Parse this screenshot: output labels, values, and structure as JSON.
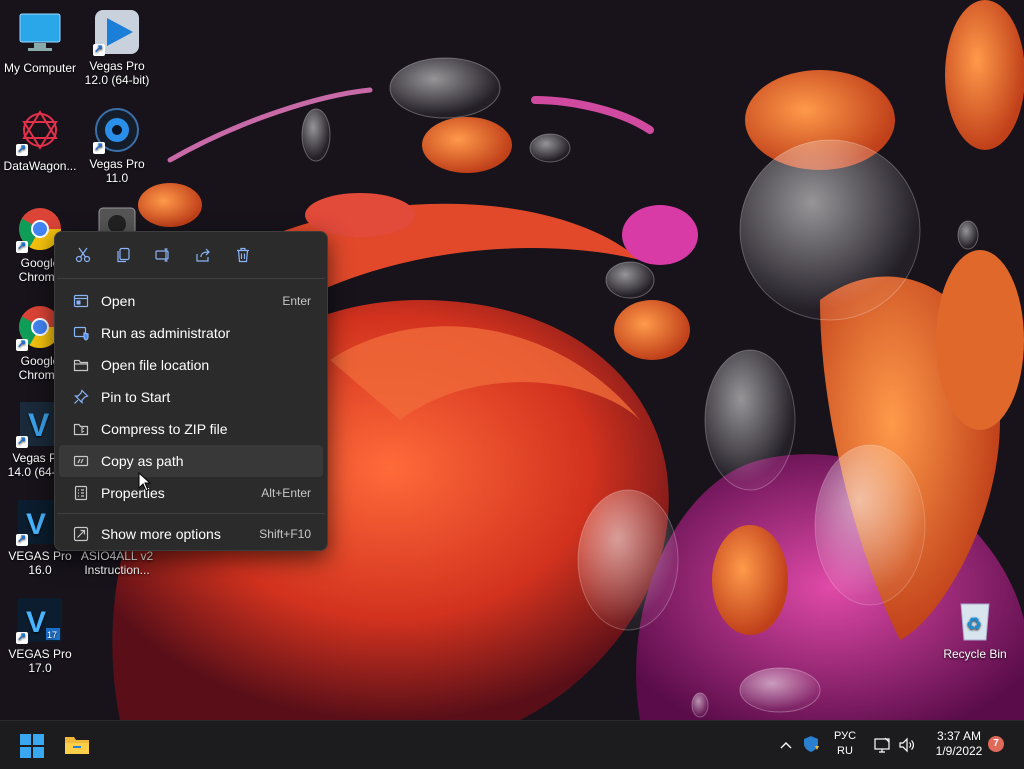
{
  "desktop": {
    "icons": [
      {
        "label": "My Computer"
      },
      {
        "label": "Vegas Pro 12.0 (64-bit)"
      },
      {
        "label": "DataWagon..."
      },
      {
        "label": "Vegas Pro 11.0"
      },
      {
        "label": "Google Chrome"
      },
      {
        "label": "Google Chrome"
      },
      {
        "label": "Vegas Pro 14.0 (64-bit)"
      },
      {
        "label": "VEGAS Pro 16.0"
      },
      {
        "label": "ASIO4ALL v2 Instruction..."
      },
      {
        "label": "VEGAS Pro 17.0"
      },
      {
        "label": "Recycle Bin"
      }
    ]
  },
  "context_menu": {
    "toolbar": [
      "cut-icon",
      "copy-icon",
      "rename-icon",
      "share-icon",
      "delete-icon"
    ],
    "items": [
      {
        "label": "Open",
        "shortcut": "Enter",
        "icon": "open-icon"
      },
      {
        "label": "Run as administrator",
        "shortcut": "",
        "icon": "shield-icon"
      },
      {
        "label": "Open file location",
        "shortcut": "",
        "icon": "folder-icon"
      },
      {
        "label": "Pin to Start",
        "shortcut": "",
        "icon": "pin-icon"
      },
      {
        "label": "Compress to ZIP file",
        "shortcut": "",
        "icon": "zip-icon"
      },
      {
        "label": "Copy as path",
        "shortcut": "",
        "icon": "path-icon"
      },
      {
        "label": "Properties",
        "shortcut": "Alt+Enter",
        "icon": "properties-icon"
      },
      {
        "label": "Show more options",
        "shortcut": "Shift+F10",
        "icon": "more-options-icon"
      }
    ]
  },
  "taskbar": {
    "lang_top": "РУС",
    "lang_bottom": "RU",
    "time": "3:37 AM",
    "date": "1/9/2022",
    "notification_count": "7"
  },
  "colors": {
    "accent": "#0078d4",
    "menu_bg": "#2b2b2b",
    "taskbar_bg": "#1c1c1e"
  }
}
